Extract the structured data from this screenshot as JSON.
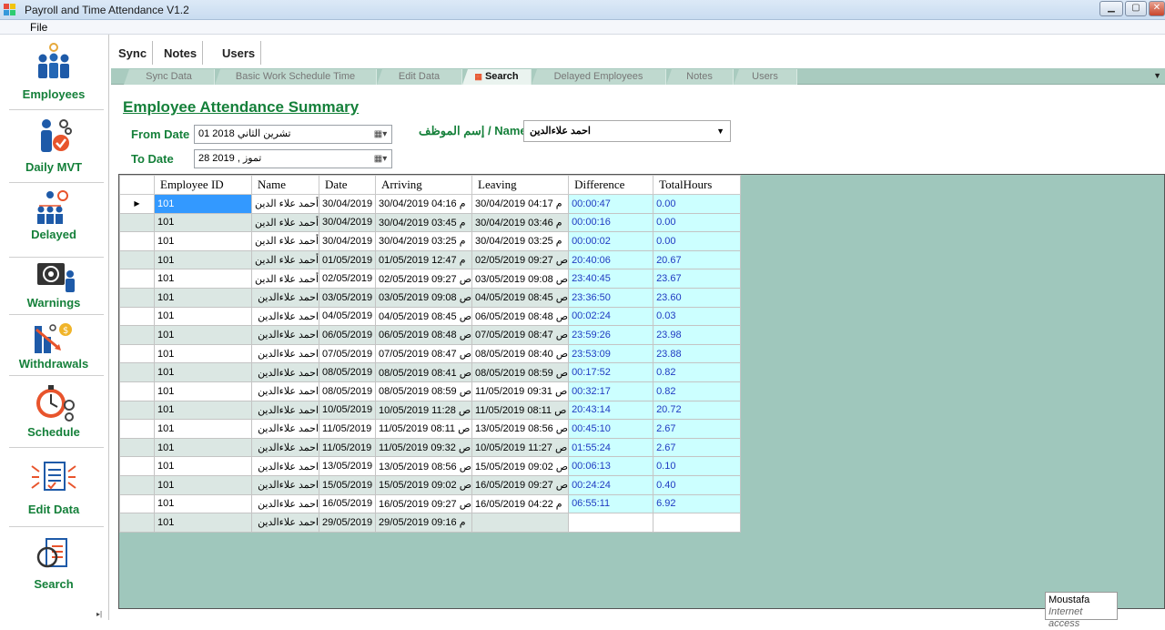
{
  "window": {
    "title": "Payroll and Time Attendance V1.2",
    "minimize_icon": "minimize-icon",
    "maximize_icon": "maximize-icon",
    "close_icon": "close-icon"
  },
  "menu": {
    "file": "File"
  },
  "sidebar": {
    "items": [
      {
        "label": "Employees",
        "icon": "employees-icon"
      },
      {
        "label": "Daily MVT",
        "icon": "daily-mvt-icon"
      },
      {
        "label": "Delayed",
        "icon": "delayed-icon"
      },
      {
        "label": "Warnings",
        "icon": "warnings-icon"
      },
      {
        "label": "Withdrawals",
        "icon": "withdrawals-icon"
      },
      {
        "label": "Schedule",
        "icon": "schedule-icon"
      },
      {
        "label": "Edit Data",
        "icon": "edit-data-icon"
      },
      {
        "label": "Search",
        "icon": "search-icon"
      }
    ]
  },
  "top_tabs": [
    "Sync",
    "Notes",
    "Users"
  ],
  "sub_tabs": [
    "Sync Data",
    "Basic Work Schedule Time",
    "Edit Data",
    "Search",
    "Delayed Employees",
    "Notes",
    "Users"
  ],
  "active_sub_tab": "Search",
  "summary": {
    "title": "Employee Attendance Summary",
    "from_label": "From Date",
    "from_value": "01 تشرين الثاني 2018",
    "to_label": "To Date",
    "to_value": "28   تموز  , 2019",
    "name_label": "إسم الموظف / Name",
    "name_value": "احمد علاءالدين"
  },
  "grid": {
    "columns": [
      "Employee ID",
      "Name",
      "Date",
      "Arriving",
      "Leaving",
      "Difference",
      "TotalHours"
    ],
    "rows": [
      [
        "101",
        "أحمد علاء الدين",
        "30/04/2019",
        "30/04/2019 04:16 م",
        "30/04/2019 04:17 م",
        "00:00:47",
        "0.00"
      ],
      [
        "101",
        "أحمد علاء الدين",
        "30/04/2019",
        "30/04/2019 03:45 م",
        "30/04/2019 03:46 م",
        "00:00:16",
        "0.00"
      ],
      [
        "101",
        "أحمد علاء الدين",
        "30/04/2019",
        "30/04/2019 03:25 م",
        "30/04/2019 03:25 م",
        "00:00:02",
        "0.00"
      ],
      [
        "101",
        "أحمد علاء الدين",
        "01/05/2019",
        "01/05/2019 12:47 م",
        "02/05/2019 09:27 ص",
        "20:40:06",
        "20.67"
      ],
      [
        "101",
        "أحمد علاء الدين",
        "02/05/2019",
        "02/05/2019 09:27 ص",
        "03/05/2019 09:08 ص",
        "23:40:45",
        "23.67"
      ],
      [
        "101",
        "احمد علاءالدين",
        "03/05/2019",
        "03/05/2019 09:08 ص",
        "04/05/2019 08:45 ص",
        "23:36:50",
        "23.60"
      ],
      [
        "101",
        "احمد علاءالدين",
        "04/05/2019",
        "04/05/2019 08:45 ص",
        "06/05/2019 08:48 ص",
        "00:02:24",
        "0.03"
      ],
      [
        "101",
        "احمد علاءالدين",
        "06/05/2019",
        "06/05/2019 08:48 ص",
        "07/05/2019 08:47 ص",
        "23:59:26",
        "23.98"
      ],
      [
        "101",
        "احمد علاءالدين",
        "07/05/2019",
        "07/05/2019 08:47 ص",
        "08/05/2019 08:40 ص",
        "23:53:09",
        "23.88"
      ],
      [
        "101",
        "احمد علاءالدين",
        "08/05/2019",
        "08/05/2019 08:41 ص",
        "08/05/2019 08:59 ص",
        "00:17:52",
        "0.82"
      ],
      [
        "101",
        "احمد علاءالدين",
        "08/05/2019",
        "08/05/2019 08:59 ص",
        "11/05/2019 09:31 ص",
        "00:32:17",
        "0.82"
      ],
      [
        "101",
        "احمد علاءالدين",
        "10/05/2019",
        "10/05/2019 11:28 ص",
        "11/05/2019 08:11 ص",
        "20:43:14",
        "20.72"
      ],
      [
        "101",
        "احمد علاءالدين",
        "11/05/2019",
        "11/05/2019 08:11 ص",
        "13/05/2019 08:56 ص",
        "00:45:10",
        "2.67"
      ],
      [
        "101",
        "احمد علاءالدين",
        "11/05/2019",
        "11/05/2019 09:32 ص",
        "10/05/2019 11:27 ص",
        "01:55:24",
        "2.67"
      ],
      [
        "101",
        "احمد علاءالدين",
        "13/05/2019",
        "13/05/2019 08:56 ص",
        "15/05/2019 09:02 ص",
        "00:06:13",
        "0.10"
      ],
      [
        "101",
        "احمد علاءالدين",
        "15/05/2019",
        "15/05/2019 09:02 ص",
        "16/05/2019 09:27 ص",
        "00:24:24",
        "0.40"
      ],
      [
        "101",
        "احمد علاءالدين",
        "16/05/2019",
        "16/05/2019 09:27 ص",
        "16/05/2019 04:22 م",
        "06:55:11",
        "6.92"
      ],
      [
        "101",
        "احمد علاءالدين",
        "29/05/2019",
        "29/05/2019 09:16 م",
        "",
        "",
        ""
      ]
    ],
    "selected_row": 0
  },
  "tooltip": {
    "user": "Moustafa",
    "status": "Internet access"
  }
}
